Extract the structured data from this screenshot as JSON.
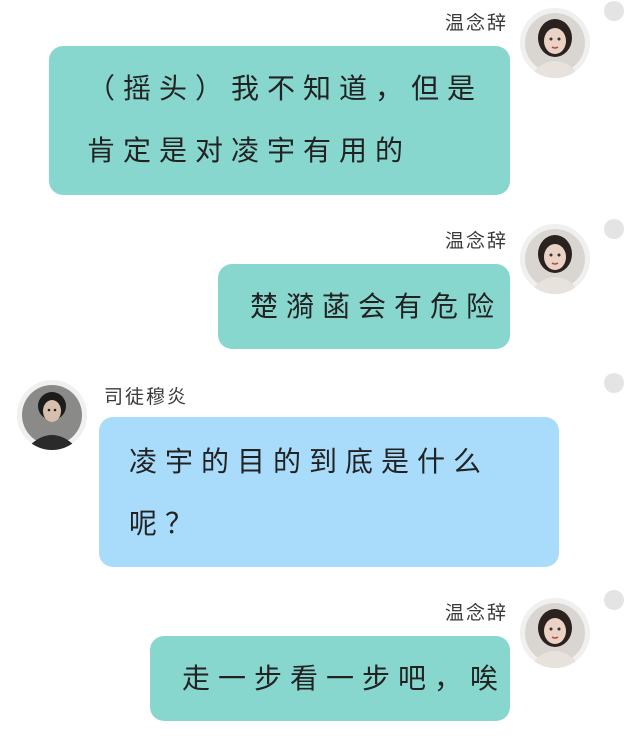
{
  "messages": [
    {
      "sender": "温念辞",
      "side": "right",
      "bubble_color": "#88d7cf",
      "avatar": "female-avatar",
      "lines": [
        "（摇头）我不知道，但是",
        "肯定是对凌宇有用的"
      ]
    },
    {
      "sender": "温念辞",
      "side": "right",
      "bubble_color": "#88d7cf",
      "avatar": "female-avatar",
      "lines": [
        "楚漪菡会有危险"
      ]
    },
    {
      "sender": "司徒穆炎",
      "side": "left",
      "bubble_color": "#a9dcfb",
      "avatar": "male-avatar",
      "lines": [
        "凌宇的目的到底是什么",
        "呢？"
      ]
    },
    {
      "sender": "温念辞",
      "side": "right",
      "bubble_color": "#88d7cf",
      "avatar": "female-avatar",
      "lines": [
        "走一步看一步吧，唉"
      ]
    }
  ],
  "colors": {
    "background": "#ffffff",
    "teal_bubble": "#88d7cf",
    "blue_bubble": "#a9dcfb",
    "select_circle": "#e4e4e4"
  }
}
